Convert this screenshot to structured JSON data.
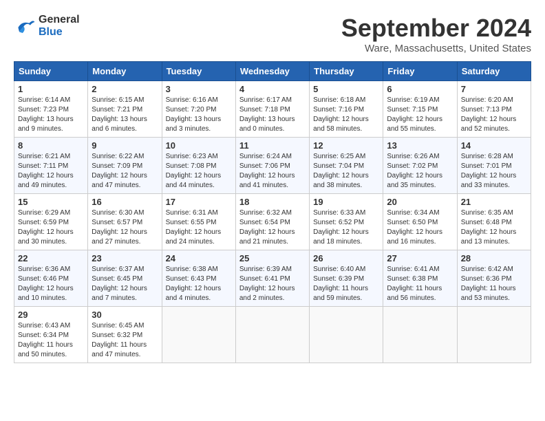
{
  "header": {
    "logo_line1": "General",
    "logo_line2": "Blue",
    "main_title": "September 2024",
    "subtitle": "Ware, Massachusetts, United States"
  },
  "weekdays": [
    "Sunday",
    "Monday",
    "Tuesday",
    "Wednesday",
    "Thursday",
    "Friday",
    "Saturday"
  ],
  "weeks": [
    [
      {
        "day": "1",
        "sunrise": "6:14 AM",
        "sunset": "7:23 PM",
        "daylight": "13 hours and 9 minutes."
      },
      {
        "day": "2",
        "sunrise": "6:15 AM",
        "sunset": "7:21 PM",
        "daylight": "13 hours and 6 minutes."
      },
      {
        "day": "3",
        "sunrise": "6:16 AM",
        "sunset": "7:20 PM",
        "daylight": "13 hours and 3 minutes."
      },
      {
        "day": "4",
        "sunrise": "6:17 AM",
        "sunset": "7:18 PM",
        "daylight": "13 hours and 0 minutes."
      },
      {
        "day": "5",
        "sunrise": "6:18 AM",
        "sunset": "7:16 PM",
        "daylight": "12 hours and 58 minutes."
      },
      {
        "day": "6",
        "sunrise": "6:19 AM",
        "sunset": "7:15 PM",
        "daylight": "12 hours and 55 minutes."
      },
      {
        "day": "7",
        "sunrise": "6:20 AM",
        "sunset": "7:13 PM",
        "daylight": "12 hours and 52 minutes."
      }
    ],
    [
      {
        "day": "8",
        "sunrise": "6:21 AM",
        "sunset": "7:11 PM",
        "daylight": "12 hours and 49 minutes."
      },
      {
        "day": "9",
        "sunrise": "6:22 AM",
        "sunset": "7:09 PM",
        "daylight": "12 hours and 47 minutes."
      },
      {
        "day": "10",
        "sunrise": "6:23 AM",
        "sunset": "7:08 PM",
        "daylight": "12 hours and 44 minutes."
      },
      {
        "day": "11",
        "sunrise": "6:24 AM",
        "sunset": "7:06 PM",
        "daylight": "12 hours and 41 minutes."
      },
      {
        "day": "12",
        "sunrise": "6:25 AM",
        "sunset": "7:04 PM",
        "daylight": "12 hours and 38 minutes."
      },
      {
        "day": "13",
        "sunrise": "6:26 AM",
        "sunset": "7:02 PM",
        "daylight": "12 hours and 35 minutes."
      },
      {
        "day": "14",
        "sunrise": "6:28 AM",
        "sunset": "7:01 PM",
        "daylight": "12 hours and 33 minutes."
      }
    ],
    [
      {
        "day": "15",
        "sunrise": "6:29 AM",
        "sunset": "6:59 PM",
        "daylight": "12 hours and 30 minutes."
      },
      {
        "day": "16",
        "sunrise": "6:30 AM",
        "sunset": "6:57 PM",
        "daylight": "12 hours and 27 minutes."
      },
      {
        "day": "17",
        "sunrise": "6:31 AM",
        "sunset": "6:55 PM",
        "daylight": "12 hours and 24 minutes."
      },
      {
        "day": "18",
        "sunrise": "6:32 AM",
        "sunset": "6:54 PM",
        "daylight": "12 hours and 21 minutes."
      },
      {
        "day": "19",
        "sunrise": "6:33 AM",
        "sunset": "6:52 PM",
        "daylight": "12 hours and 18 minutes."
      },
      {
        "day": "20",
        "sunrise": "6:34 AM",
        "sunset": "6:50 PM",
        "daylight": "12 hours and 16 minutes."
      },
      {
        "day": "21",
        "sunrise": "6:35 AM",
        "sunset": "6:48 PM",
        "daylight": "12 hours and 13 minutes."
      }
    ],
    [
      {
        "day": "22",
        "sunrise": "6:36 AM",
        "sunset": "6:46 PM",
        "daylight": "12 hours and 10 minutes."
      },
      {
        "day": "23",
        "sunrise": "6:37 AM",
        "sunset": "6:45 PM",
        "daylight": "12 hours and 7 minutes."
      },
      {
        "day": "24",
        "sunrise": "6:38 AM",
        "sunset": "6:43 PM",
        "daylight": "12 hours and 4 minutes."
      },
      {
        "day": "25",
        "sunrise": "6:39 AM",
        "sunset": "6:41 PM",
        "daylight": "12 hours and 2 minutes."
      },
      {
        "day": "26",
        "sunrise": "6:40 AM",
        "sunset": "6:39 PM",
        "daylight": "11 hours and 59 minutes."
      },
      {
        "day": "27",
        "sunrise": "6:41 AM",
        "sunset": "6:38 PM",
        "daylight": "11 hours and 56 minutes."
      },
      {
        "day": "28",
        "sunrise": "6:42 AM",
        "sunset": "6:36 PM",
        "daylight": "11 hours and 53 minutes."
      }
    ],
    [
      {
        "day": "29",
        "sunrise": "6:43 AM",
        "sunset": "6:34 PM",
        "daylight": "11 hours and 50 minutes."
      },
      {
        "day": "30",
        "sunrise": "6:45 AM",
        "sunset": "6:32 PM",
        "daylight": "11 hours and 47 minutes."
      },
      null,
      null,
      null,
      null,
      null
    ]
  ]
}
